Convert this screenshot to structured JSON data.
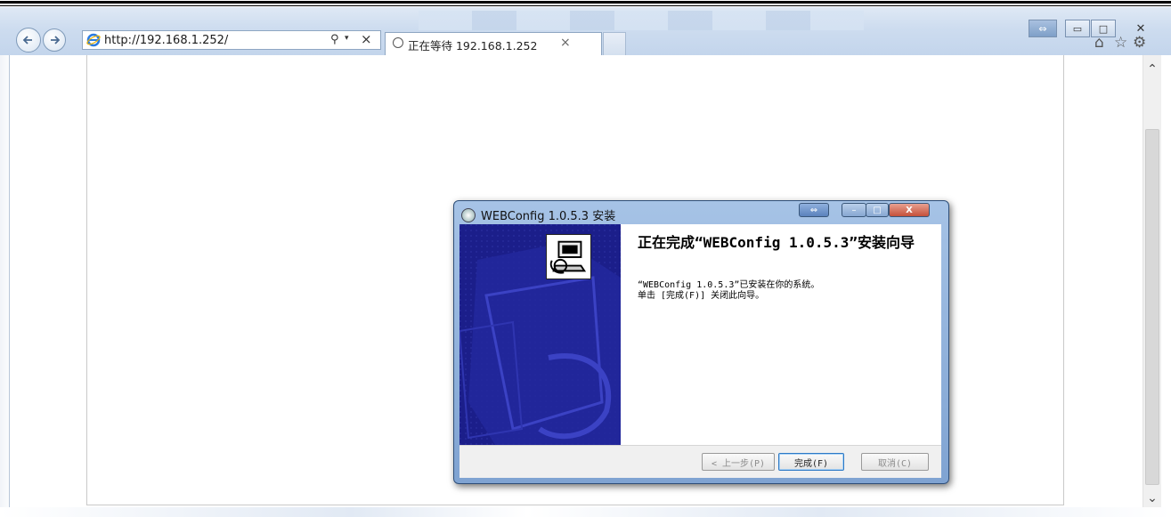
{
  "browser": {
    "address_url": "http://192.168.1.252/",
    "search_icon": "search-icon",
    "stop_icon": "stop-icon",
    "tab": {
      "title": "正在等待 192.168.1.252",
      "close": "×"
    },
    "icons": [
      "back-arrow-icon",
      "forward-arrow-icon",
      "ie-logo-icon",
      "home-icon",
      "star-icon",
      "gear-icon"
    ]
  },
  "window_controls": {
    "minimize": "▭",
    "maximize": "□",
    "close": "✕"
  },
  "scrollbar": {
    "up": "⌃",
    "down": "⌄"
  },
  "dialog": {
    "title": "WEBConfig 1.0.5.3 安装",
    "heading": "正在完成“WEBConfig 1.0.5.3”安装向导",
    "line1": "“WEBConfig 1.0.5.3”已安装在你的系统。",
    "line2": "单击 [完成(F)] 关闭此向导。",
    "buttons": {
      "back": "< 上一步(P)",
      "finish": "完成(F)",
      "cancel": "取消(C)"
    },
    "controls": {
      "close": "X"
    }
  },
  "colors": {
    "banner": "#1b1e8a",
    "chrome": "#cddcef",
    "dialog_frame": "#a6c3e6"
  }
}
